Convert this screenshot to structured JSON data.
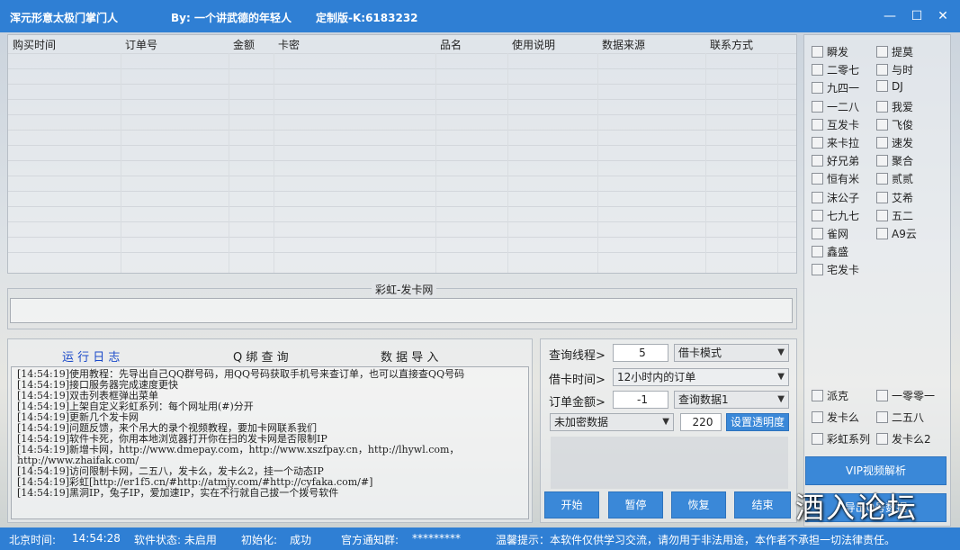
{
  "titlebar": {
    "app_name": "浑元形意太极门掌门人",
    "by": "By:  一个讲武德的年轻人",
    "edition": "定制版-K:6183232",
    "min_glyph": "—",
    "max_glyph": "☐",
    "close_glyph": "✕"
  },
  "table": {
    "headers": [
      "购买时间",
      "订单号",
      "金额",
      "卡密",
      "品名",
      "使用说明",
      "数据来源",
      "联系方式"
    ]
  },
  "source_group": {
    "title": "彩虹-发卡网",
    "input_value": ""
  },
  "log_panel": {
    "tabs": [
      "运 行 日 志",
      "Q 绑 查 询",
      "数 据 导 入"
    ],
    "lines": [
      "[14:54:19]使用教程：先导出自己QQ群号码，用QQ号码获取手机号来查订单，也可以直接查QQ号码",
      "[14:54:19]接口服务器完成速度更快",
      "[14:54:19]双击列表框弹出菜单",
      "[14:54:19]上架自定义彩虹系列：每个网址用(#)分开",
      "[14:54:19]更新几个发卡网",
      "[14:54:19]问题反馈，来个吊大的录个视频教程，要加卡网联系我们",
      "[14:54:19]软件卡死，你用本地浏览器打开你在扫的发卡网是否限制IP",
      "[14:54:19]新增卡网，http://www.dmepay.com，http://www.xszfpay.cn，http://lhywl.com，",
      "http://www.zhaifak.com/",
      "[14:54:19]访问限制卡网，二五八，发卡么，发卡么2，挂一个动态IP",
      "[14:54:19]彩虹[http://er1f5.cn/#http://atmjy.com/#http://cyfaka.com/#]",
      "[14:54:19]黑洞IP，兔子IP，爱加速IP，实在不行就自己拔一个拨号软件"
    ]
  },
  "controls": {
    "thread_label": "查询线程>",
    "thread_value": "5",
    "mode_select": "借卡模式",
    "time_label": "借卡时间>",
    "time_select": "12小时内的订单",
    "amount_label": "订单金额>",
    "amount_value": "-1",
    "data_select": "查询数据1",
    "encrypt_select": "未加密数据",
    "opacity_value": "220",
    "opacity_button": "设置透明度",
    "start": "开始",
    "pause": "暂停",
    "resume": "恢复",
    "stop": "结束"
  },
  "sites_left": [
    "瞬发",
    "二零七",
    "九四一",
    "一二八",
    "互发卡",
    "来卡拉",
    "好兄弟",
    "恒有米",
    "沫公子",
    "七九七",
    "雀网",
    "鑫盛",
    "宅发卡"
  ],
  "sites_right": [
    "提莫",
    "与时",
    "DJ",
    "我爱",
    "飞俊",
    "速发",
    "聚合",
    "贰贰",
    "艾希",
    "五二",
    "A9云"
  ],
  "sites_bottom_left": [
    "派克",
    "发卡么",
    "彩虹系列"
  ],
  "sites_bottom_right": [
    "一零零一",
    "二五八",
    "发卡么2"
  ],
  "vip_button": "VIP视频解析",
  "export_button": "导出Q号数据",
  "watermark": "酒入论坛",
  "statusbar": {
    "time_label": "北京时间:",
    "time_value": "14:54:28",
    "state_label": "软件状态: 未启用",
    "init_label": "初始化:",
    "init_value": "成功",
    "group_label": "官方通知群:",
    "group_value": "*********",
    "tip": "温馨提示：本软件仅供学习交流，请勿用于非法用途，本作者不承担一切法律责任。"
  }
}
